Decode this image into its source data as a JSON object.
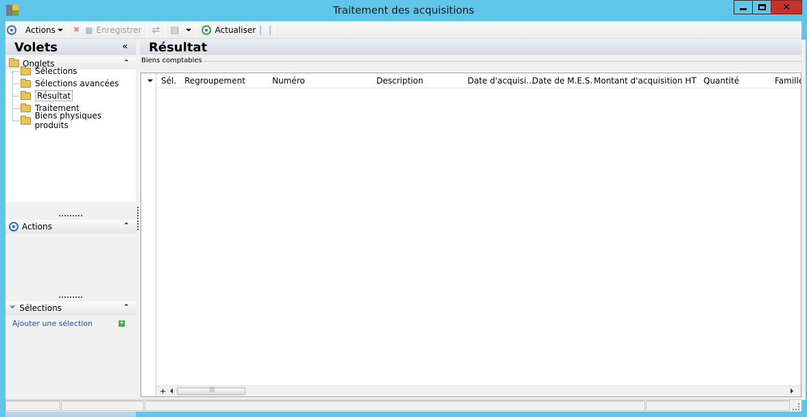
{
  "window": {
    "title": "Traitement des acquisitions"
  },
  "toolbar": {
    "actions_label": "Actions",
    "save_label": "Enregistrer",
    "refresh_label": "Actualiser"
  },
  "left_panel": {
    "title": "Volets",
    "collapse_glyph": "«",
    "tabs_section": {
      "title": "Onglets",
      "items": [
        {
          "label": "Sélections"
        },
        {
          "label": "Sélections avancées"
        },
        {
          "label": "Résultat"
        },
        {
          "label": "Traitement"
        },
        {
          "label": "Biens physiques produits"
        }
      ]
    },
    "actions_section": {
      "title": "Actions"
    },
    "selections_section": {
      "title": "Sélections",
      "add_link": "Ajouter une sélection"
    }
  },
  "main": {
    "title": "Résultat",
    "group_label": "Biens comptables",
    "grid": {
      "columns": [
        "Sél.",
        "Regroupement",
        "Numéro",
        "Description",
        "Date d'acquisi...",
        "Date de M.E.S.",
        "Montant d'acquisition HT",
        "Quantité",
        "Famille"
      ],
      "add_row_glyph": "+"
    }
  },
  "colors": {
    "frame": "#5fc6ea",
    "close_button": "#c7312b",
    "accent_blue": "#2f6fb7"
  }
}
